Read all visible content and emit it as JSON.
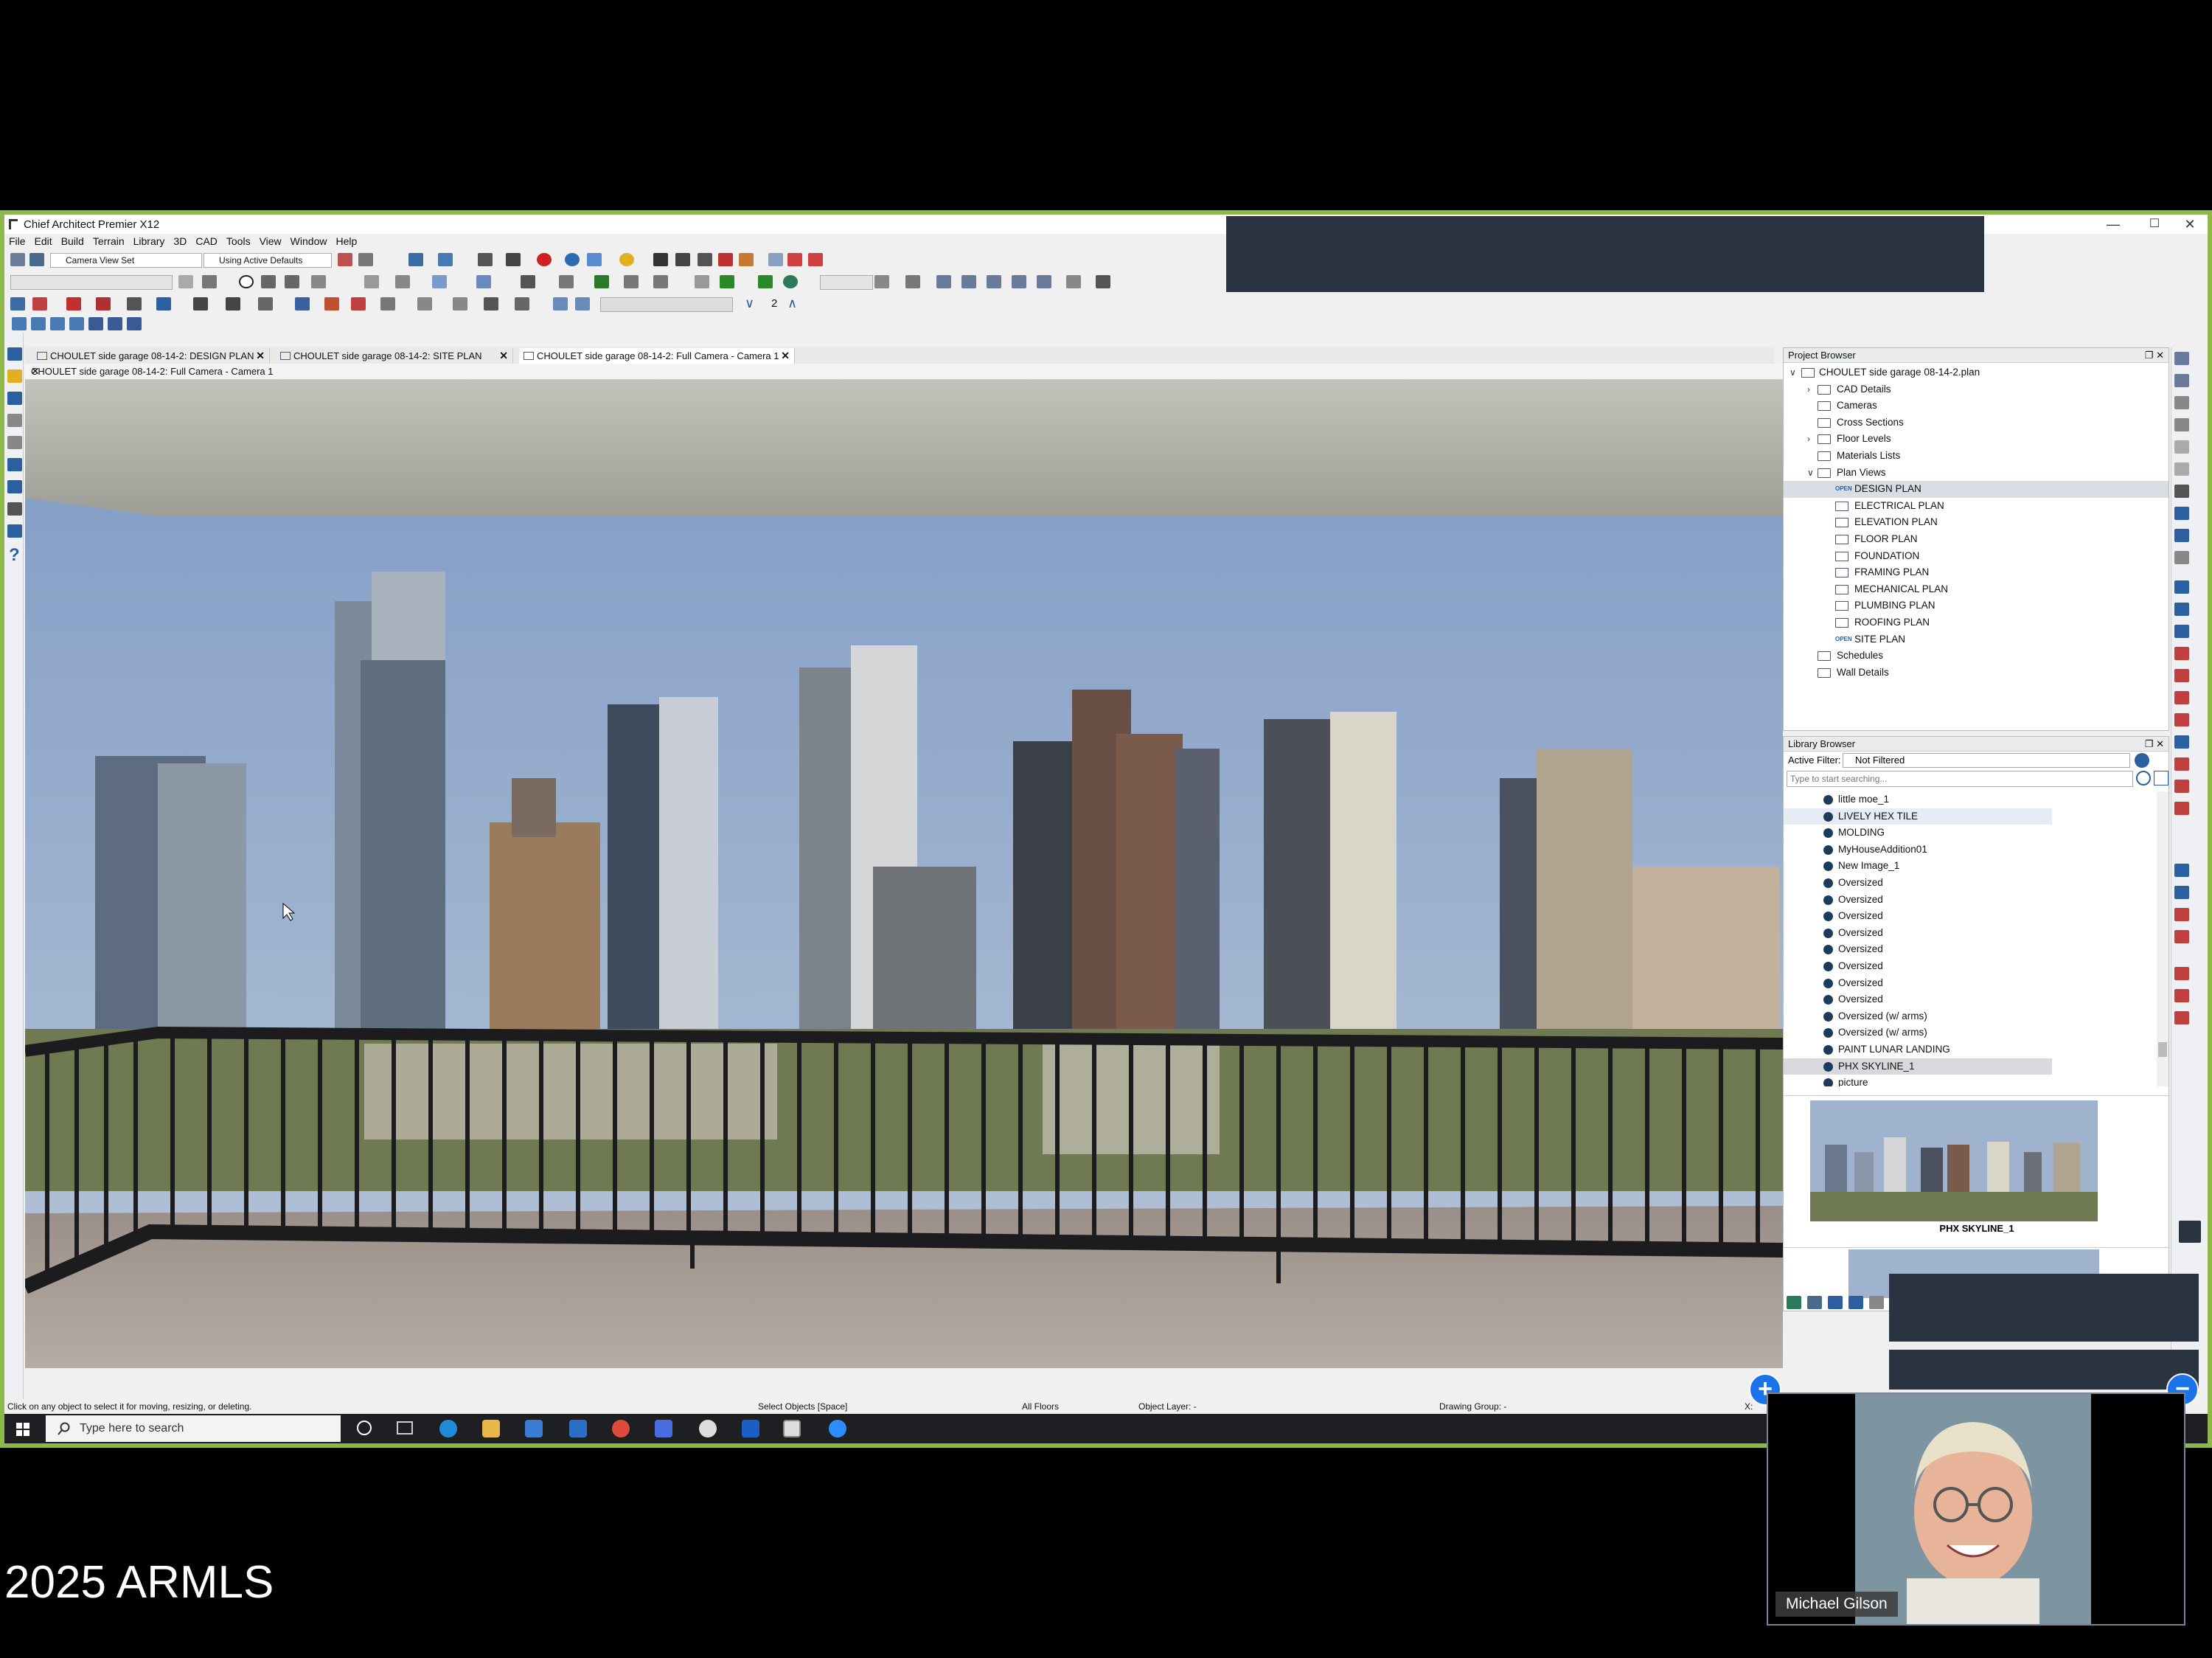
{
  "window": {
    "title": "Chief Architect Premier X12",
    "minimize": "—",
    "maximize": "☐",
    "close": "✕"
  },
  "menu": [
    "File",
    "Edit",
    "Build",
    "Terrain",
    "Library",
    "3D",
    "CAD",
    "Tools",
    "View",
    "Window",
    "Help"
  ],
  "toolbar": {
    "view_set": "Camera View Set",
    "defaults": "Using Active Defaults",
    "floor_count": "2"
  },
  "tabs": [
    {
      "label": "CHOULET side garage 08-14-2: DESIGN PLAN"
    },
    {
      "label": "CHOULET side garage 08-14-2: SITE PLAN"
    },
    {
      "label": "CHOULET side garage 08-14-2: Full Camera - Camera 1"
    }
  ],
  "view": {
    "title": "CHOULET side garage 08-14-2: Full Camera - Camera 1"
  },
  "project_browser": {
    "title": "Project Browser",
    "root": "CHOULET side garage 08-14-2.plan",
    "folders": [
      "CAD Details",
      "Cameras",
      "Cross Sections",
      "Floor Levels",
      "Materials Lists"
    ],
    "plan_views_label": "Plan Views",
    "plan_views": [
      "DESIGN PLAN",
      "ELECTRICAL PLAN",
      "ELEVATION PLAN",
      "FLOOR PLAN",
      "FOUNDATION",
      "FRAMING PLAN",
      "MECHANICAL PLAN",
      "PLUMBING PLAN",
      "ROOFING PLAN",
      "SITE PLAN"
    ],
    "open_badge": "OPEN",
    "after": [
      "Schedules",
      "Wall Details"
    ]
  },
  "library_browser": {
    "title": "Library Browser",
    "filter_label": "Active Filter:",
    "filter_value": "Not Filtered",
    "search_placeholder": "Type to start searching...",
    "items": [
      "little moe_1",
      "LIVELY HEX TILE",
      "MOLDING",
      "MyHouseAddition01",
      "New Image_1",
      "Oversized",
      "Oversized",
      "Oversized",
      "Oversized",
      "Oversized",
      "Oversized",
      "Oversized",
      "Oversized",
      "Oversized (w/ arms)",
      "Oversized (w/ arms)",
      "PAINT LUNAR LANDING",
      "PHX SKYLINE_1",
      "picture"
    ],
    "preview_label": "PHX SKYLINE_1"
  },
  "status": {
    "hint": "Click on any object to select it for moving, resizing, or deleting.",
    "mode": "Select Objects [Space]",
    "floors": "All Floors",
    "layer": "Object Layer: -",
    "group": "Drawing Group: -",
    "coord": "X:"
  },
  "taskbar": {
    "search_placeholder": "Type here to search"
  },
  "webcam": {
    "name": "Michael Gilson"
  },
  "caption": "2025 ARMLS",
  "colors": {
    "accent_border": "#8fb84a",
    "zoom_blue": "#1a73e8",
    "library_dot": "#1e3b5c"
  }
}
